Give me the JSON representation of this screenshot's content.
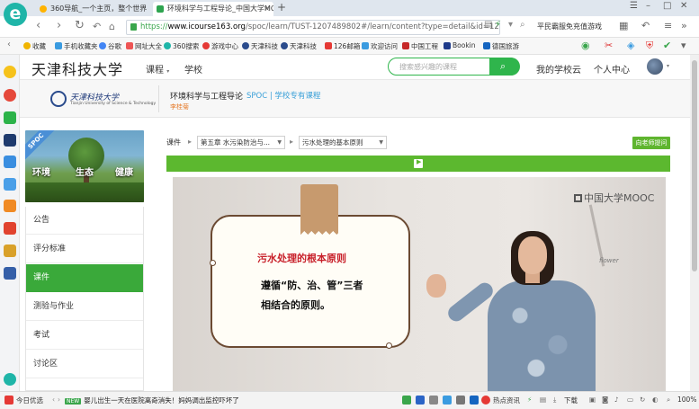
{
  "browser": {
    "tabs": [
      {
        "label": "360导航_一个主页，整个世界"
      },
      {
        "label": "环境科学与工程导论_中国大学MOOC"
      }
    ],
    "new_tab": "+",
    "address": {
      "scheme": "https://",
      "host": "www.icourse163.org",
      "path": "/spoc/learn/TUST-1207489802#/learn/content?type=detail&id=1213561("
    },
    "promo": "平民霸服免充值游戏",
    "bookmarks": [
      {
        "label": "收藏",
        "color": "#f0b400"
      },
      {
        "label": "手机收藏夹",
        "color": "#3a9be0"
      },
      {
        "label": "谷歌",
        "color": "#4285f4"
      },
      {
        "label": "网址大全",
        "color": "#e55"
      },
      {
        "label": "360搜索",
        "color": "#1fb5a8"
      },
      {
        "label": "游戏中心",
        "color": "#e53935"
      },
      {
        "label": "天津科技",
        "color": "#2a4b8c"
      },
      {
        "label": "天津科技",
        "color": "#2a4b8c"
      },
      {
        "label": "126邮箱",
        "color": "#e53935"
      },
      {
        "label": "欢迎访问",
        "color": "#3a9be0"
      },
      {
        "label": "中国工程",
        "color": "#c62828"
      },
      {
        "label": "Bookin",
        "color": "#1e3a8a"
      },
      {
        "label": "德国旅游",
        "color": "#1565c0"
      }
    ]
  },
  "site": {
    "name": "天津科技大学",
    "nav": [
      "课程",
      "学校"
    ],
    "search_placeholder": "搜索感兴趣的课程",
    "links": [
      "我的学校云",
      "个人中心"
    ]
  },
  "course": {
    "uni_logo_name": "天津科技大学",
    "uni_logo_sub": "Tianjin University of Science & Technology",
    "title": "环境科学与工程导论",
    "spoc": "SPOC | 学校专有课程",
    "teacher": "李桂菊",
    "image": {
      "ribbon": "SPOC",
      "words": [
        "环境",
        "生态",
        "健康"
      ]
    }
  },
  "menu": [
    {
      "label": "公告",
      "active": false
    },
    {
      "label": "评分标准",
      "active": false
    },
    {
      "label": "课件",
      "active": true
    },
    {
      "label": "测验与作业",
      "active": false
    },
    {
      "label": "考试",
      "active": false
    },
    {
      "label": "讨论区",
      "active": false
    }
  ],
  "crumb": {
    "label": "课件",
    "arrow": "▸",
    "chapter": "第五章 水污染防治与...",
    "lesson": "污水处理的基本原则"
  },
  "ask_button": "向老师提问",
  "video": {
    "watermark": "中国大学MOOC",
    "board_title": "污水处理的根本原则",
    "board_line1": "遵循“防、治、管”三者",
    "board_line2": "相结合的原则。",
    "decor_text": "flower"
  },
  "status": {
    "today": "今日优选",
    "news_tag": "NEW",
    "news": "婴儿出生一天在医院离奇消失！妈妈调出监控吓坏了",
    "hot": "热点资讯",
    "download": "下载",
    "zoom": "100%"
  }
}
